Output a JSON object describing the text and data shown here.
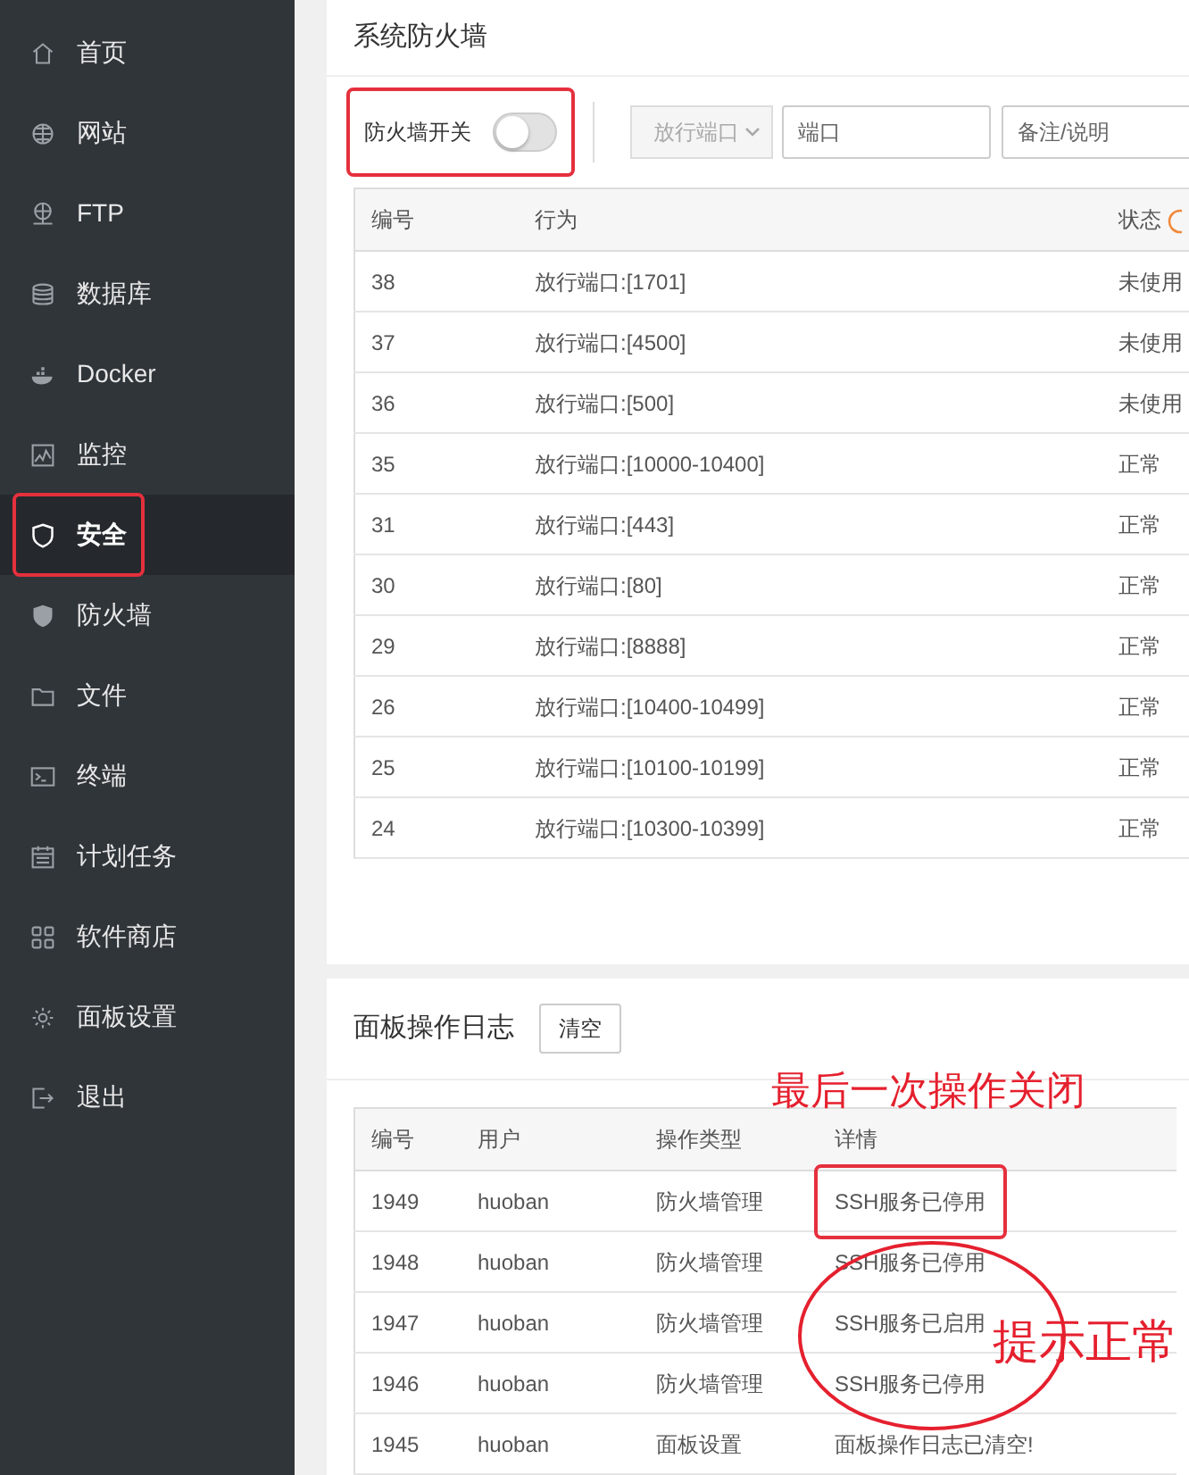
{
  "sidebar": {
    "items": [
      {
        "label": "首页",
        "selected": false,
        "highlighted": false
      },
      {
        "label": "网站",
        "selected": false,
        "highlighted": false
      },
      {
        "label": "FTP",
        "selected": false,
        "highlighted": false
      },
      {
        "label": "数据库",
        "selected": false,
        "highlighted": false
      },
      {
        "label": "Docker",
        "selected": false,
        "highlighted": false
      },
      {
        "label": "监控",
        "selected": false,
        "highlighted": false
      },
      {
        "label": "安全",
        "selected": true,
        "highlighted": true
      },
      {
        "label": "防火墙",
        "selected": false,
        "highlighted": false
      },
      {
        "label": "文件",
        "selected": false,
        "highlighted": false
      },
      {
        "label": "终端",
        "selected": false,
        "highlighted": false
      },
      {
        "label": "计划任务",
        "selected": false,
        "highlighted": false
      },
      {
        "label": "软件商店",
        "selected": false,
        "highlighted": false
      },
      {
        "label": "面板设置",
        "selected": false,
        "highlighted": false
      },
      {
        "label": "退出",
        "selected": false,
        "highlighted": false
      }
    ]
  },
  "firewall": {
    "title": "系统防火墙",
    "toggle": {
      "label": "防火墙开关",
      "on": false,
      "highlighted": true
    },
    "type_select": {
      "value": "放行端口",
      "disabled": true
    },
    "port_field": {
      "placeholder": "端口"
    },
    "note_field": {
      "placeholder": "备注/说明"
    },
    "table": {
      "columns": [
        "编号",
        "行为",
        "状态"
      ],
      "rows": [
        {
          "id": "38",
          "action": "放行端口:[1701]",
          "status": "未使用"
        },
        {
          "id": "37",
          "action": "放行端口:[4500]",
          "status": "未使用"
        },
        {
          "id": "36",
          "action": "放行端口:[500]",
          "status": "未使用"
        },
        {
          "id": "35",
          "action": "放行端口:[10000-10400]",
          "status": "正常"
        },
        {
          "id": "31",
          "action": "放行端口:[443]",
          "status": "正常"
        },
        {
          "id": "30",
          "action": "放行端口:[80]",
          "status": "正常"
        },
        {
          "id": "29",
          "action": "放行端口:[8888]",
          "status": "正常"
        },
        {
          "id": "26",
          "action": "放行端口:[10400-10499]",
          "status": "正常"
        },
        {
          "id": "25",
          "action": "放行端口:[10100-10199]",
          "status": "正常"
        },
        {
          "id": "24",
          "action": "放行端口:[10300-10399]",
          "status": "正常"
        }
      ]
    }
  },
  "log": {
    "title": "面板操作日志",
    "clear_button": "清空",
    "table": {
      "columns": [
        "编号",
        "用户",
        "操作类型",
        "详情"
      ],
      "rows": [
        {
          "id": "1949",
          "user": "huoban",
          "type": "防火墙管理",
          "detail": "SSH服务已停用",
          "highlighted": true
        },
        {
          "id": "1948",
          "user": "huoban",
          "type": "防火墙管理",
          "detail": "SSH服务已停用",
          "highlighted": false
        },
        {
          "id": "1947",
          "user": "huoban",
          "type": "防火墙管理",
          "detail": "SSH服务已启用",
          "highlighted": false
        },
        {
          "id": "1946",
          "user": "huoban",
          "type": "防火墙管理",
          "detail": "SSH服务已停用",
          "highlighted": false
        },
        {
          "id": "1945",
          "user": "huoban",
          "type": "面板设置",
          "detail": "面板操作日志已清空!",
          "highlighted": false
        }
      ]
    }
  },
  "annotations": [
    {
      "kind": "text",
      "text": "最后一次操作关闭"
    },
    {
      "kind": "ellipse"
    },
    {
      "kind": "text",
      "text": "提示正常"
    }
  ]
}
